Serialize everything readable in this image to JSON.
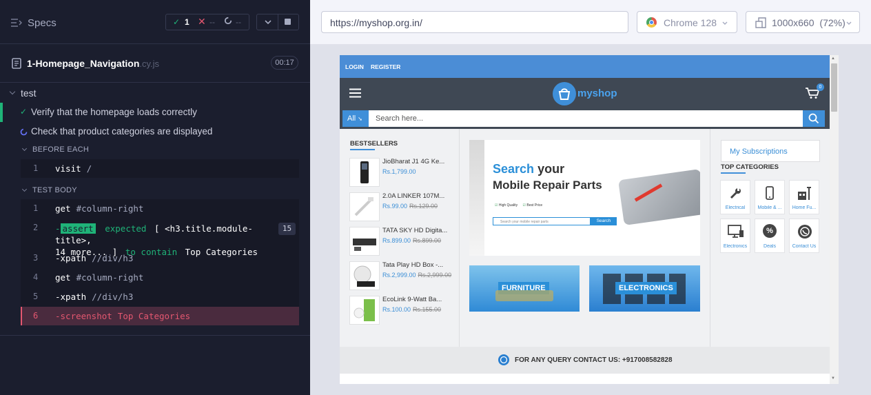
{
  "runner": {
    "specs_label": "Specs",
    "stats": {
      "passed": "1",
      "failed": "--",
      "pending": "--"
    },
    "file": {
      "name": "1-Homepage_Navigation",
      "ext": ".cy.js",
      "duration": "00:17"
    },
    "suite": "test",
    "tests": [
      {
        "label": "Verify that the homepage loads correctly",
        "state": "passed"
      },
      {
        "label": "Check that product categories are displayed",
        "state": "running"
      }
    ],
    "before_each_label": "BEFORE EACH",
    "before_each": [
      {
        "num": "1",
        "name": "visit",
        "arg": "/"
      }
    ],
    "test_body_label": "TEST BODY",
    "commands": [
      {
        "num": "1",
        "name": "get",
        "arg": "#column-right"
      },
      {
        "num": "2",
        "prefix": "-",
        "name": "assert",
        "text_a": "expected",
        "text_b": "[ <h3.title.module-title>,",
        "count": "15",
        "text_c": "14 more... ]",
        "text_d": "to contain",
        "text_e": "Top Categories"
      },
      {
        "num": "3",
        "name": "-xpath",
        "arg": "//div/h3"
      },
      {
        "num": "4",
        "name": "get",
        "arg": "#column-right"
      },
      {
        "num": "5",
        "name": "-xpath",
        "arg": "//div/h3"
      },
      {
        "num": "6",
        "name": "-screenshot",
        "arg": "Top Categories"
      }
    ]
  },
  "browser": {
    "url": "https://myshop.org.in/",
    "name": "Chrome 128",
    "viewport": "1000x660",
    "zoom": "(72%)"
  },
  "site": {
    "login": "LOGIN",
    "register": "REGISTER",
    "logo": "myshop",
    "cart_count": "0",
    "search_category": "All",
    "search_placeholder": "Search here...",
    "bestsellers_title": "BESTSELLERS",
    "products": [
      {
        "name": "JioBharat J1 4G Ke...",
        "price": "Rs.1,799.00",
        "old": ""
      },
      {
        "name": "2.0A LINKER 107M...",
        "price": "Rs.99.00",
        "old": "Rs.129.00"
      },
      {
        "name": "TATA SKY HD Digita...",
        "price": "Rs.899.00",
        "old": "Rs.899.00"
      },
      {
        "name": "Tata Play HD Box -...",
        "price": "Rs.2,999.00",
        "old": "Rs.2,999.00"
      },
      {
        "name": "EcoLink 9-Watt Ba...",
        "price": "Rs.100.00",
        "old": "Rs.155.00"
      }
    ],
    "banner": {
      "line1_accent": "Search",
      "line1_rest": "your",
      "line2": "Mobile Repair Parts",
      "badge1": "High Quality",
      "badge2": "Best Price",
      "input_placeholder": "Search your mobile repair parts",
      "button": "Search"
    },
    "promo_furniture": "FURNITURE",
    "promo_electronics": "ELECTRONICS",
    "subscriptions": "My Subscriptions",
    "top_categories_title": "TOP CATEGORIES",
    "categories": [
      {
        "label": "Electrical",
        "icon": "wrench-icon"
      },
      {
        "label": "Mobile & ...",
        "icon": "mobile-icon"
      },
      {
        "label": "Home Fu...",
        "icon": "home-furniture-icon"
      },
      {
        "label": "Electronics",
        "icon": "monitor-icon"
      },
      {
        "label": "Deals",
        "icon": "percent-icon"
      },
      {
        "label": "Contact Us",
        "icon": "whatsapp-icon"
      }
    ],
    "footer_query": "FOR ANY QUERY CONTACT US: +917008582828"
  }
}
